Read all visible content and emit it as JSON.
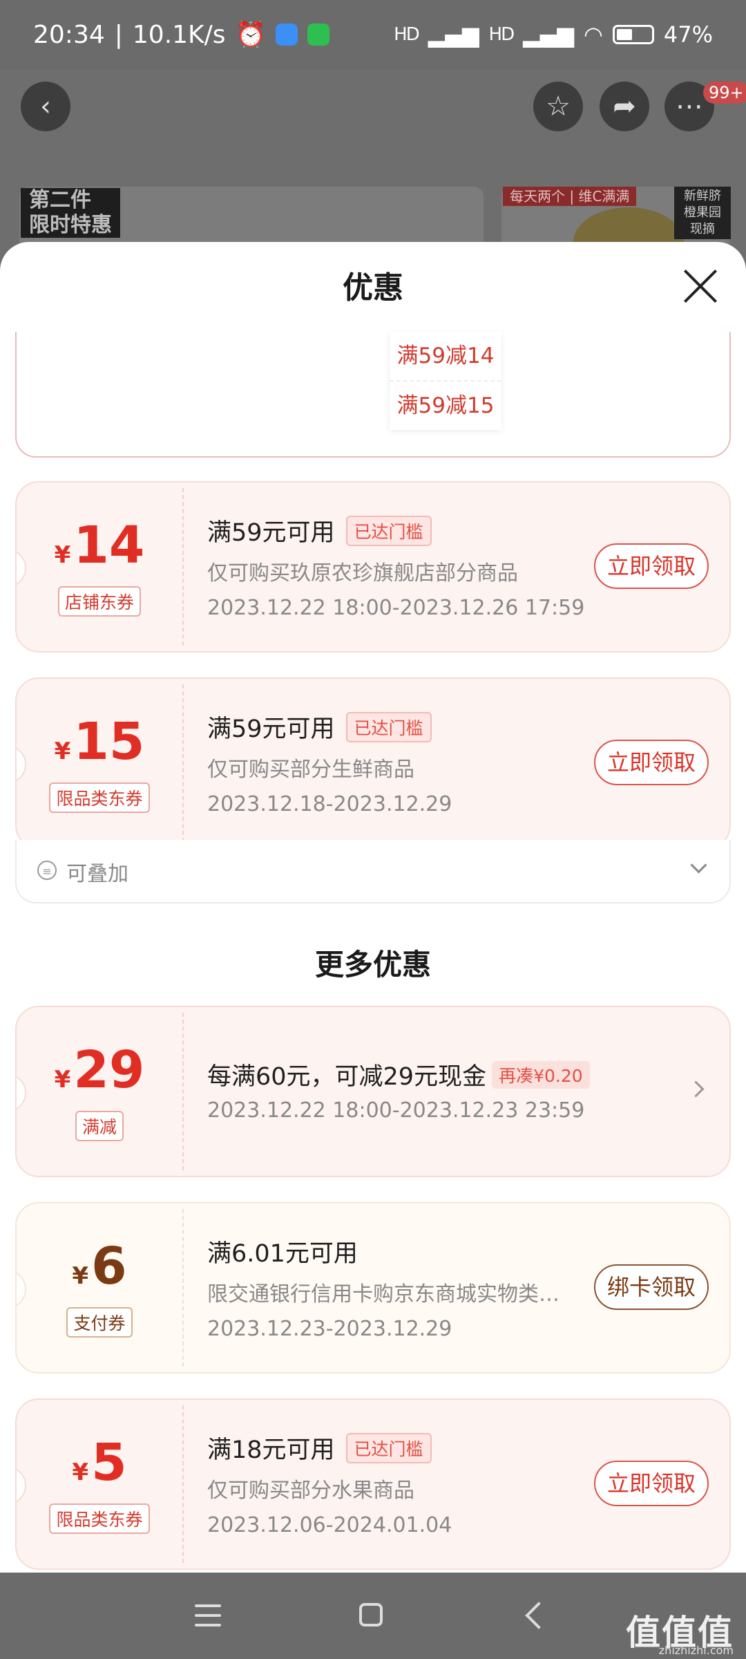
{
  "status_bar": {
    "time": "20:34",
    "speed": "10.1K/s",
    "signal1": "HD",
    "signal2": "HD",
    "battery": "47%",
    "battery_level": 0.47
  },
  "header": {
    "back_icon": "chevron-left-icon",
    "favorite_icon": "star-icon",
    "share_icon": "share-icon",
    "more_icon": "more-dots-icon",
    "more_badge": "99+"
  },
  "background": {
    "promo_tag_line1": "第二件",
    "promo_tag_line2": "限时特惠",
    "promo_tag2": "每天两个 | 维C满满",
    "promo_tag3": "新鲜脐橙果园现摘"
  },
  "sheet": {
    "title": "优惠",
    "close_icon": "close-icon",
    "dropdown_items": [
      "满59减14",
      "满59减15"
    ],
    "coupons": [
      {
        "amount": "14",
        "type": "店铺东券",
        "title": "满59元可用",
        "tag": "已达门槛",
        "desc": "仅可购买玖原农珍旗舰店部分商品",
        "date": "2023.12.22 18:00-2023.12.26 17:59",
        "button": "立即领取"
      },
      {
        "amount": "15",
        "type": "限品类东券",
        "title": "满59元可用",
        "tag": "已达门槛",
        "desc": "仅可购买部分生鲜商品",
        "date": "2023.12.18-2023.12.29",
        "button": "立即领取"
      }
    ],
    "stackable_label": "可叠加",
    "more_title": "更多优惠",
    "more_coupons": [
      {
        "amount": "29",
        "type": "满减",
        "title": "每满60元，可减29元现金",
        "tag": "再凑¥0.20",
        "date": "2023.12.22 18:00-2023.12.23 23:59"
      },
      {
        "amount": "6",
        "type": "支付券",
        "title": "满6.01元可用",
        "desc": "限交通银行信用卡购京东商城实物类…",
        "date": "2023.12.23-2023.12.29",
        "button": "绑卡领取"
      },
      {
        "amount": "5",
        "type": "限品类东券",
        "title": "满18元可用",
        "tag": "已达门槛",
        "desc": "仅可购买部分水果商品",
        "date": "2023.12.06-2024.01.04",
        "button": "立即领取"
      }
    ],
    "currency": "¥"
  },
  "watermark": {
    "text": "值值值",
    "sub": "zhizhizhi.com"
  },
  "colors": {
    "accent_red": "#e02e24",
    "pay_brown": "#7a3b14",
    "card_bg": "#fdf3f1"
  }
}
